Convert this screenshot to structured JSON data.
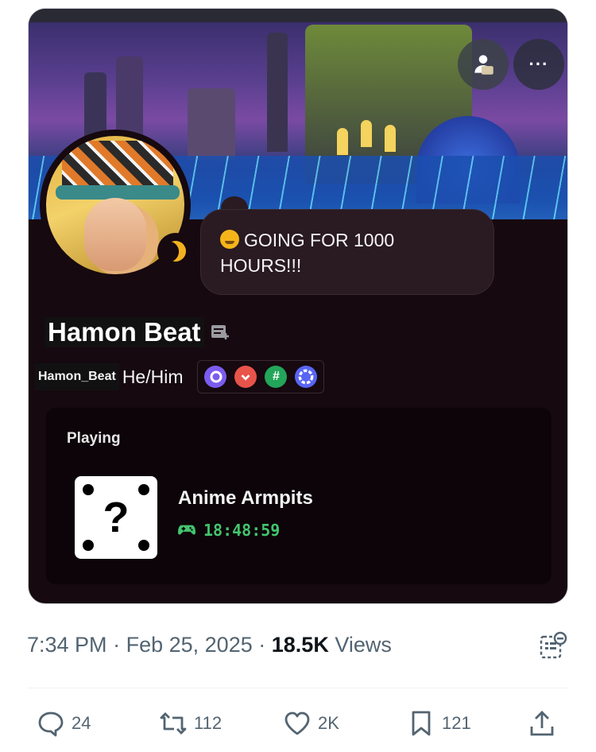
{
  "card": {
    "status_message": "GOING FOR 1000 HOURS!!!",
    "display_name": "Hamon Beat",
    "username": "Hamon_Beat",
    "pronouns": "He/Him",
    "activity": {
      "heading": "Playing",
      "game": "Anime Armpits",
      "elapsed": "18:48:59"
    },
    "badges": [
      "hypesquad-icon",
      "nitro-icon",
      "hashtag-icon",
      "quest-icon"
    ],
    "colors": {
      "background": "#16090f",
      "timer": "#43c46e",
      "badge_purple": "#7b5cf0",
      "badge_red": "#e8534a",
      "badge_green": "#23a55a",
      "badge_blue": "#5865f2"
    }
  },
  "tweet": {
    "time": "7:34 PM",
    "separator": "·",
    "date": "Feb 25, 2025",
    "views_count": "18.5K",
    "views_label": "Views",
    "replies": "24",
    "retweets": "112",
    "likes": "2K",
    "bookmarks": "121"
  }
}
